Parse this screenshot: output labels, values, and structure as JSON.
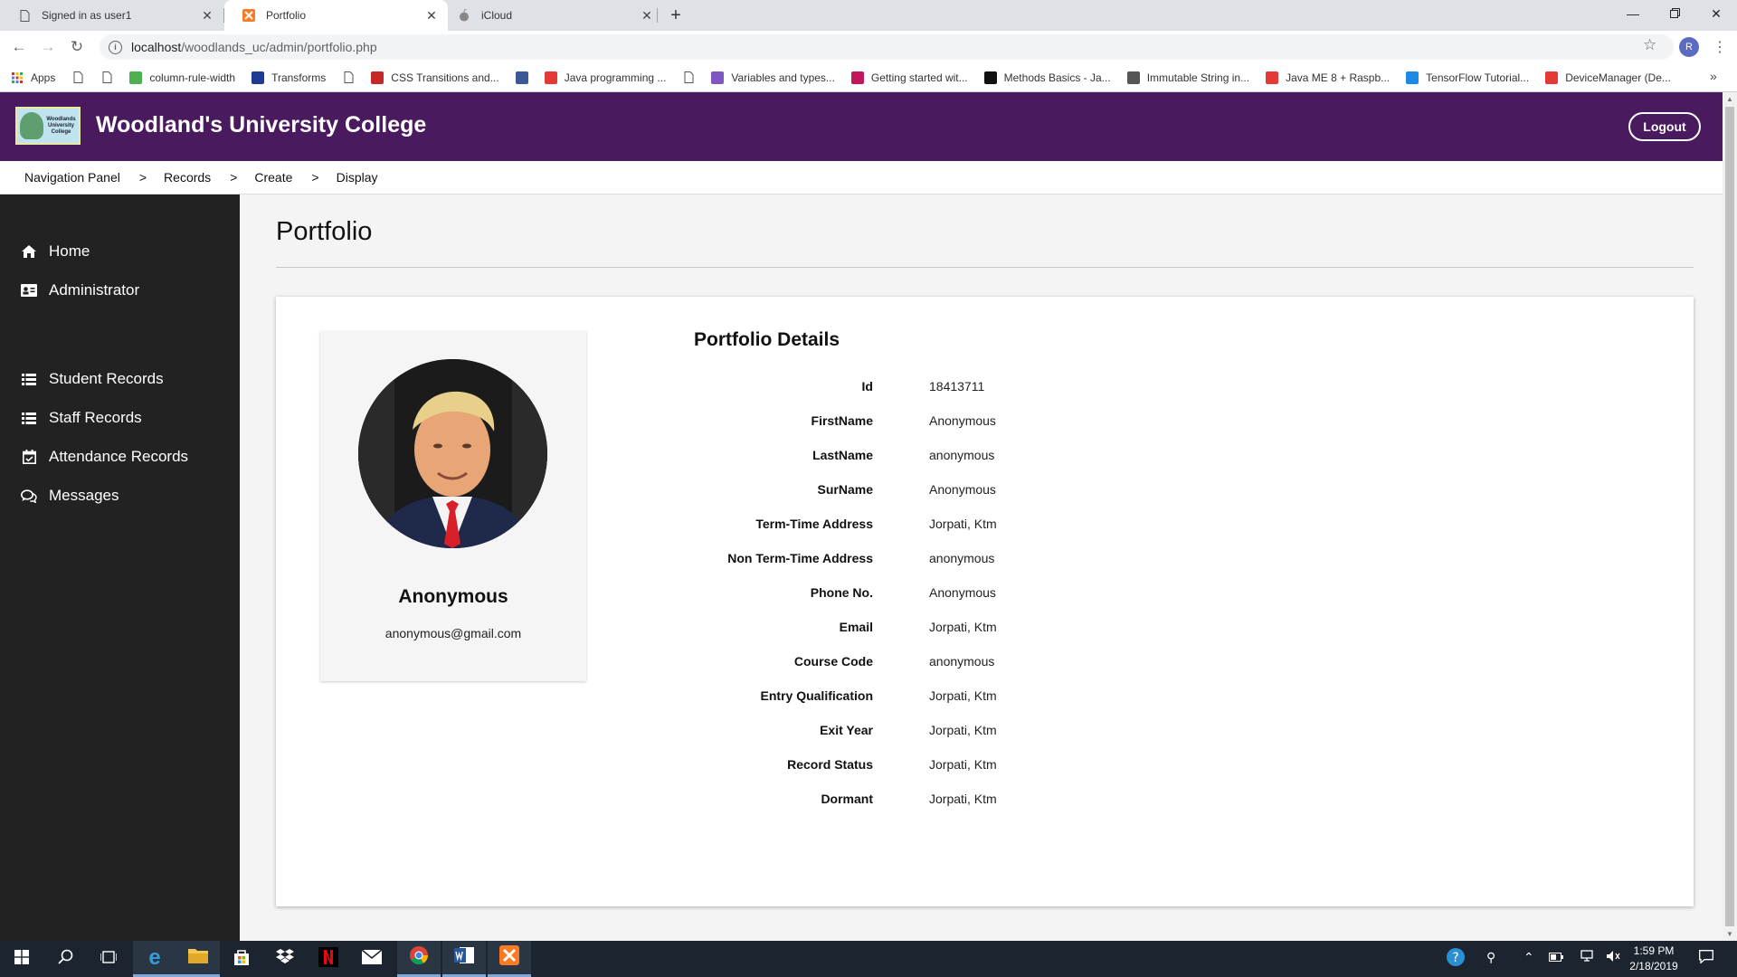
{
  "browser": {
    "tabs": [
      {
        "title": "Signed in as user1",
        "icon": "document-icon",
        "active": false
      },
      {
        "title": "Portfolio",
        "icon": "xampp-icon",
        "active": true
      },
      {
        "title": "iCloud",
        "icon": "apple-icon",
        "active": false
      }
    ],
    "new_tab_icon": "+",
    "url_host": "localhost",
    "url_path": "/woodlands_uc/admin/portfolio.php",
    "profile_initial": "R",
    "bookmarks": [
      {
        "label": "Apps",
        "icon": "apps-grid-icon",
        "color": "#d93025"
      },
      {
        "label": "",
        "icon": "document-icon",
        "color": "#ffffff"
      },
      {
        "label": "",
        "icon": "document-icon",
        "color": "#ffffff"
      },
      {
        "label": "column-rule-width",
        "icon": "w3-icon",
        "color": "#4caf50"
      },
      {
        "label": "Transforms",
        "icon": "bird-icon",
        "color": "#1f3a93"
      },
      {
        "label": "",
        "icon": "document-icon",
        "color": "#ffffff"
      },
      {
        "label": "CSS Transitions and...",
        "icon": "site-icon",
        "color": "#c62828"
      },
      {
        "label": "",
        "icon": "facebook-icon",
        "color": "#3b5998"
      },
      {
        "label": "Java programming ...",
        "icon": "site-icon",
        "color": "#e53935"
      },
      {
        "label": "",
        "icon": "document-icon",
        "color": "#ffffff"
      },
      {
        "label": "Variables and types...",
        "icon": "site-icon",
        "color": "#7e57c2"
      },
      {
        "label": "Getting started wit...",
        "icon": "raspberry-icon",
        "color": "#c2185b"
      },
      {
        "label": "Methods Basics - Ja...",
        "icon": "sf-icon",
        "color": "#111111"
      },
      {
        "label": "Immutable String in...",
        "icon": "t-icon",
        "color": "#555555"
      },
      {
        "label": "Java ME 8 + Raspb...",
        "icon": "oracle-icon",
        "color": "#e53935"
      },
      {
        "label": "TensorFlow Tutorial...",
        "icon": "shield-icon",
        "color": "#1e88e5"
      },
      {
        "label": "DeviceManager (De...",
        "icon": "oracle-icon",
        "color": "#e53935"
      }
    ]
  },
  "header": {
    "logo_text": "Woodlands University College",
    "brand": "Woodland's University College",
    "logout_label": "Logout"
  },
  "breadcrumb": [
    "Navigation Panel",
    "Records",
    "Create",
    "Display"
  ],
  "breadcrumb_sep": ">",
  "sidebar": {
    "items": [
      {
        "label": "Home",
        "icon": "home-icon"
      },
      {
        "label": "Administrator",
        "icon": "id-card-icon"
      },
      {
        "label": "Student Records",
        "icon": "list-icon"
      },
      {
        "label": "Staff Records",
        "icon": "list-icon"
      },
      {
        "label": "Attendance Records",
        "icon": "calendar-check-icon"
      },
      {
        "label": "Messages",
        "icon": "comments-icon"
      }
    ]
  },
  "page": {
    "title": "Portfolio",
    "profile": {
      "name": "Anonymous",
      "email": "anonymous@gmail.com"
    },
    "details_title": "Portfolio Details",
    "details": [
      {
        "label": "Id",
        "value": "18413711"
      },
      {
        "label": "FirstName",
        "value": "Anonymous"
      },
      {
        "label": "LastName",
        "value": "anonymous"
      },
      {
        "label": "SurName",
        "value": "Anonymous"
      },
      {
        "label": "Term-Time Address",
        "value": "Jorpati, Ktm"
      },
      {
        "label": "Non Term-Time Address",
        "value": "anonymous"
      },
      {
        "label": "Phone No.",
        "value": "Anonymous"
      },
      {
        "label": "Email",
        "value": "Jorpati, Ktm"
      },
      {
        "label": "Course Code",
        "value": "anonymous"
      },
      {
        "label": "Entry Qualification",
        "value": "Jorpati, Ktm"
      },
      {
        "label": "Exit Year",
        "value": "Jorpati, Ktm"
      },
      {
        "label": "Record Status",
        "value": "Jorpati, Ktm"
      },
      {
        "label": "Dormant",
        "value": "Jorpati, Ktm"
      }
    ]
  },
  "taskbar": {
    "time": "1:59 PM",
    "date": "2/18/2019",
    "apps": [
      "windows-start-icon",
      "search-icon",
      "task-view-icon",
      "edge-icon",
      "file-explorer-icon",
      "store-icon",
      "dropbox-icon",
      "netflix-icon",
      "mail-icon",
      "chrome-icon",
      "word-icon",
      "xampp-icon"
    ]
  },
  "colors": {
    "header_bg": "#4a1a5e",
    "sidebar_bg": "#222222"
  }
}
